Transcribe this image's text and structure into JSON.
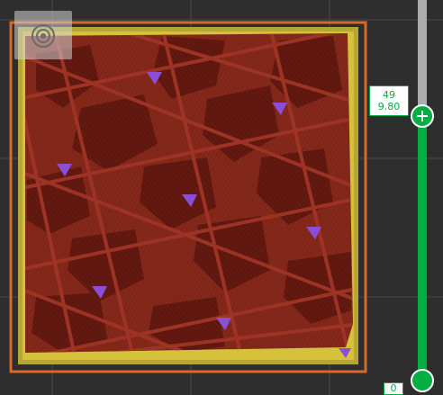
{
  "viewport": {
    "colors": {
      "background": "#2e2e2e",
      "grid": "#4a4a4a",
      "skirt": "#d9692a",
      "outer_wall": "#d6c13a",
      "inner_wall": "#b8a634",
      "infill_fill": "#7f2619",
      "infill_dark": "#5c150d",
      "infill_line": "#9c3324",
      "highlight": "#8a4fd6"
    },
    "legend_icon": "legend-toggle-icon"
  },
  "layer_slider": {
    "top_layer": "49",
    "top_height": "9.80",
    "bottom_layer": "0",
    "accent_color": "#00ae42"
  }
}
